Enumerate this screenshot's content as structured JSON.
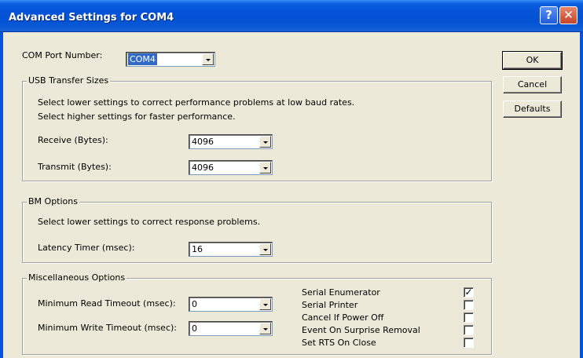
{
  "window": {
    "title": "Advanced Settings for COM4",
    "help_glyph": "?",
    "close_glyph": "✕"
  },
  "com_port": {
    "label": "COM Port Number:",
    "value": "COM4"
  },
  "buttons": {
    "ok": "OK",
    "cancel": "Cancel",
    "defaults": "Defaults"
  },
  "usb": {
    "title": "USB Transfer Sizes",
    "desc1": "Select lower settings to correct performance problems at low baud rates.",
    "desc2": "Select higher settings for faster performance.",
    "receive_label": "Receive (Bytes):",
    "receive_value": "4096",
    "transmit_label": "Transmit (Bytes):",
    "transmit_value": "4096"
  },
  "bm": {
    "title": "BM Options",
    "desc": "Select lower settings to correct response problems.",
    "latency_label": "Latency Timer (msec):",
    "latency_value": "16"
  },
  "misc": {
    "title": "Miscellaneous Options",
    "min_read_label": "Minimum Read Timeout (msec):",
    "min_read_value": "0",
    "min_write_label": "Minimum Write Timeout (msec):",
    "min_write_value": "0",
    "options": [
      {
        "label": "Serial Enumerator",
        "checked": true
      },
      {
        "label": "Serial Printer",
        "checked": false
      },
      {
        "label": "Cancel If Power Off",
        "checked": false
      },
      {
        "label": "Event On Surprise Removal",
        "checked": false
      },
      {
        "label": "Set RTS On Close",
        "checked": false
      }
    ]
  }
}
